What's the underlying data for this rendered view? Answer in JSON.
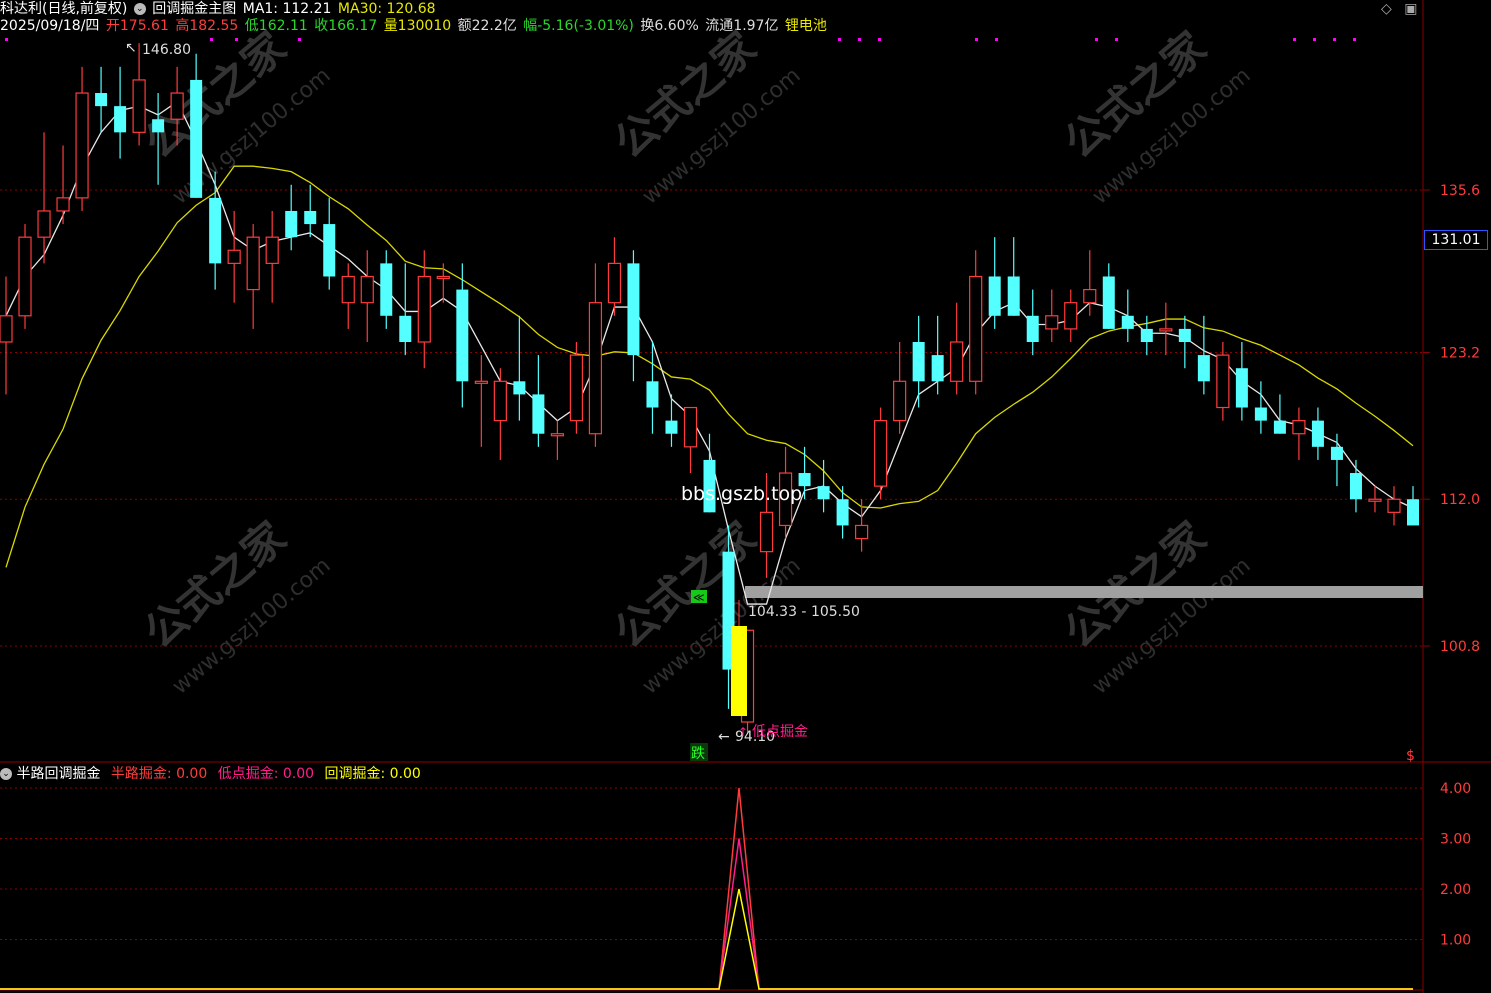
{
  "header": {
    "stock_name": "科达利(日线,前复权)",
    "formula_name": "回调掘金主图",
    "ma1_label": "MA1: 112.21",
    "ma30_label": "MA30: 120.68",
    "date": "2025/09/18/四",
    "open": "开175.61",
    "high": "高182.55",
    "low": "低162.11",
    "close": "收166.17",
    "volume": "量130010",
    "amount": "额22.2亿",
    "change": "幅-5.16(-3.01%)",
    "turnover": "换6.60%",
    "float": "流通1.97亿",
    "sector": "锂电池"
  },
  "price_axis": [
    "135.6",
    "123.2",
    "112.0",
    "100.8"
  ],
  "current_price": "131.01",
  "annotations": {
    "high_marker": "146.80",
    "low_marker": "94.10",
    "zone_label": "104.33 - 105.50",
    "watermark_text": "bbs.gszb.top",
    "signal_label": "低点掘金",
    "fall_label": "跌",
    "dollar_label": "$"
  },
  "watermark": {
    "cn": "公式之家",
    "en": "www.gszj100.com"
  },
  "indicator": {
    "name": "半路回调掘金",
    "line1": "半路掘金: 0.00",
    "line2": "低点掘金: 0.00",
    "line3": "回调掘金: 0.00",
    "axis": [
      "4.00",
      "3.00",
      "2.00",
      "1.00"
    ]
  },
  "colors": {
    "up": "#ff3c3c",
    "down": "#54ffff",
    "ma1": "#e8e8e8",
    "ma30": "#d8d800",
    "grid": "#8b0000",
    "accent_magenta": "#ff1e8c",
    "yellow": "#ffff00"
  },
  "chart_data": {
    "type": "candlestick",
    "price_min": 94.1,
    "price_max": 146.8,
    "candles": [
      [
        124,
        129,
        120,
        126
      ],
      [
        126,
        133,
        125,
        132
      ],
      [
        132,
        140,
        130,
        134
      ],
      [
        134,
        139,
        133,
        135
      ],
      [
        135,
        145,
        134,
        143
      ],
      [
        143,
        145,
        140,
        142
      ],
      [
        142,
        145,
        138,
        140
      ],
      [
        140,
        146.8,
        139,
        144
      ],
      [
        141,
        143,
        136,
        140
      ],
      [
        141,
        145,
        139,
        143
      ],
      [
        144,
        146,
        135,
        135
      ],
      [
        135,
        137,
        128,
        130
      ],
      [
        130,
        134,
        127,
        131
      ],
      [
        128,
        133,
        125,
        132
      ],
      [
        130,
        134,
        127,
        132
      ],
      [
        134,
        136,
        131,
        132
      ],
      [
        134,
        136,
        132,
        133
      ],
      [
        133,
        135,
        128,
        129
      ],
      [
        127,
        130,
        125,
        129
      ],
      [
        127,
        131,
        124,
        129
      ],
      [
        130,
        131,
        125,
        126
      ],
      [
        126,
        130,
        123,
        124
      ],
      [
        124,
        131,
        122,
        129
      ],
      [
        129,
        130,
        127,
        129
      ],
      [
        128,
        130,
        119,
        121
      ],
      [
        121,
        123,
        116,
        121
      ],
      [
        118,
        122,
        115,
        121
      ],
      [
        121,
        126,
        118,
        120
      ],
      [
        120,
        123,
        116,
        117
      ],
      [
        117,
        118,
        115,
        117
      ],
      [
        118,
        124,
        117,
        123
      ],
      [
        117,
        130,
        116,
        127
      ],
      [
        127,
        132,
        126,
        130
      ],
      [
        130,
        131,
        121,
        123
      ],
      [
        121,
        124,
        117,
        119
      ],
      [
        118,
        120,
        116,
        117
      ],
      [
        116,
        119,
        114,
        119
      ],
      [
        115,
        117,
        111,
        111
      ],
      [
        108,
        110,
        96,
        99
      ],
      [
        95,
        98,
        94.1,
        102
      ],
      [
        108,
        114,
        106,
        111
      ],
      [
        110,
        116,
        109,
        114
      ],
      [
        114,
        116,
        112,
        113
      ],
      [
        113,
        115,
        111,
        112
      ],
      [
        112,
        113,
        109,
        110
      ],
      [
        109,
        112,
        108,
        110
      ],
      [
        113,
        119,
        112,
        118
      ],
      [
        118,
        124,
        117,
        121
      ],
      [
        124,
        126,
        119,
        121
      ],
      [
        123,
        126,
        120,
        121
      ],
      [
        121,
        127,
        120,
        124
      ],
      [
        121,
        131,
        120,
        129
      ],
      [
        129,
        132,
        125,
        126
      ],
      [
        129,
        132,
        126,
        126
      ],
      [
        126,
        128,
        123,
        124
      ],
      [
        125,
        128,
        124,
        126
      ],
      [
        125,
        128,
        124,
        127
      ],
      [
        127,
        131,
        126,
        128
      ],
      [
        129,
        130,
        125,
        125
      ],
      [
        126,
        128,
        124,
        125
      ],
      [
        125,
        126,
        123,
        124
      ],
      [
        125,
        127,
        123,
        125
      ],
      [
        125,
        126,
        122,
        124
      ],
      [
        123,
        126,
        120,
        121
      ],
      [
        119,
        124,
        118,
        123
      ],
      [
        122,
        124,
        118,
        119
      ],
      [
        119,
        121,
        117,
        118
      ],
      [
        118,
        120,
        117,
        117
      ],
      [
        117,
        119,
        115,
        118
      ],
      [
        118,
        119,
        115,
        116
      ],
      [
        116,
        117,
        113,
        115
      ],
      [
        114,
        115,
        111,
        112
      ],
      [
        112,
        113,
        111,
        112
      ],
      [
        111,
        113,
        110,
        112
      ],
      [
        112,
        113,
        110,
        110
      ]
    ],
    "indicator_series": [
      {
        "name": "半路掘金",
        "peak": 4.0
      },
      {
        "name": "低点掘金",
        "peak": 3.0
      },
      {
        "name": "回调掘金",
        "peak": 2.0
      }
    ],
    "ind_ylim": [
      0,
      4.4
    ]
  }
}
